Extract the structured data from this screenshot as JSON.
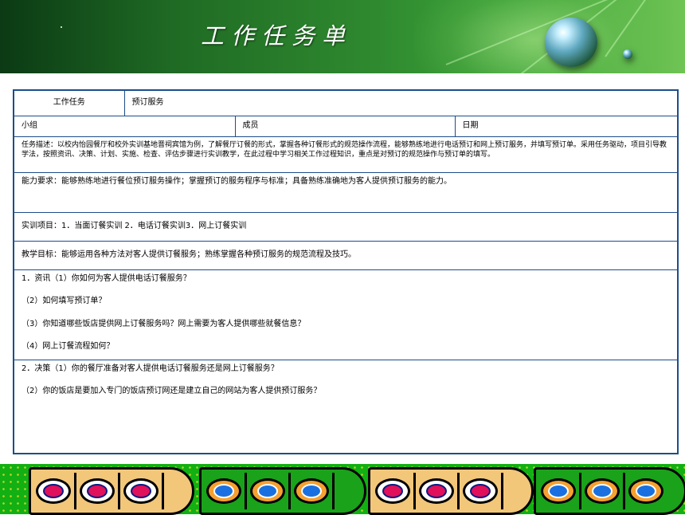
{
  "header": {
    "title": "工作任务单"
  },
  "table": {
    "task_label": "工作任务",
    "task_value": "预订服务",
    "group_label": "小组",
    "member_label": "成员",
    "date_label": "日期",
    "task_description": "任务描述：以校内怡园餐厅和校外实训基地晋祠宾馆为例，了解餐厅订餐的形式，掌握各种订餐形式的规范操作流程，能够熟练地进行电话预订和网上预订服务，并填写预订单。采用任务驱动，项目引导教学法，按照资讯、决策、计划、实施、检查、评估步骤进行实训教学，在此过程中学习相关工作过程知识，重点是对预订的规范操作与预订单的填写。",
    "ability_requirement": "能力要求：能够熟练地进行餐位预订服务操作；掌握预订的服务程序与标准；具备熟练准确地为客人提供预订服务的能力。",
    "training_items": "实训项目：1．当面订餐实训 2．电话订餐实训3．网上订餐实训",
    "teaching_goal": "教学目标：能够运用各种方法对客人提供订餐服务；熟练掌握各种预订服务的规范流程及技巧。",
    "section1": [
      "1．资讯（1）你如何为客人提供电话订餐服务？",
      "（2）如何填写预订单？",
      "（3）你知道哪些饭店提供网上订餐服务吗？网上需要为客人提供哪些就餐信息？",
      "（4）网上订餐流程如何？"
    ],
    "section2": [
      "2．决策（1）你的餐厅准备对客人提供电话订餐服务还是网上订餐服务？",
      "（2）你的饭店是要加入专门的饭店预订网还是建立自己的网站为客人提供预订服务？"
    ]
  },
  "colors": {
    "table_border": "#1d4d8a",
    "banner_green": "#2f8a2f",
    "footer_green": "#12b012"
  }
}
